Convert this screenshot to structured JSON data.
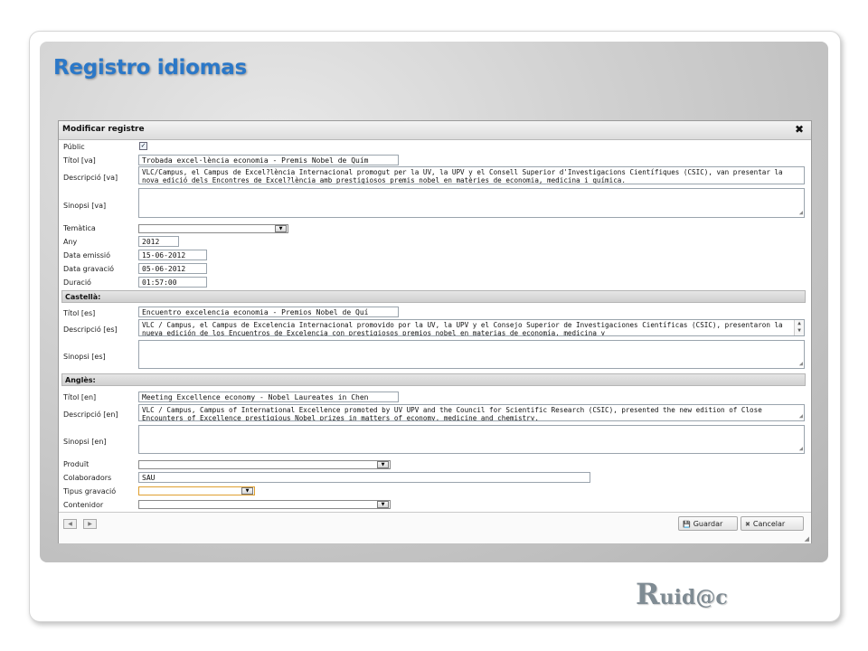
{
  "slide": {
    "title": "Registro idiomas",
    "logo_initial": "R",
    "logo_rest": "uid@c"
  },
  "dialog": {
    "title": "Modificar registre",
    "close_icon": "✖",
    "labels": {
      "public": "Públic",
      "titol_va": "Títol [va]",
      "descripcio_va": "Descripció [va]",
      "sinopsi_va": "Sinopsi [va]",
      "tematica": "Temàtica",
      "any": "Any",
      "data_emissio": "Data emissió",
      "data_gravacio": "Data gravació",
      "duracio": "Duració",
      "titol_es": "Títol [es]",
      "descripcio_es": "Descripció [es]",
      "sinopsi_es": "Sinopsi [es]",
      "titol_en": "Títol [en]",
      "descripcio_en": "Descripció [en]",
      "sinopsi_en": "Sinopsi [en]",
      "produit": "Produït",
      "colaboradors": "Colaboradors",
      "tipus_gravacio": "Tipus gravació",
      "contenidor": "Contenidor"
    },
    "values": {
      "public_checked": "✓",
      "titol_va": "Trobada excel·lència economia - Premis Nobel de Quím",
      "descripcio_va": "VLC/Campus, el Campus de Excel?lència Internacional promogut per la UV, la UPV y el Consell Superior d'Investigacions Científiques (CSIC), van presentar la nova edició dels  Encontres de Excel?lència amb prestigiosos premis nobel en matèries de economia, medicina i química.",
      "sinopsi_va": "",
      "any": "2012",
      "data_emissio": "15-06-2012",
      "data_gravacio": "05-06-2012",
      "duracio": "01:57:00",
      "titol_es": "Encuentro excelencia economia - Premios Nobel de Quí",
      "descripcio_es": "VLC / Campus, el Campus de Excelencia Internacional promovido por la UV, la UPV y el Consejo Superior de Investigaciones Científicas (CSIC), presentaron la nueva edición de los Encuentros de Excelencia con prestigiosos premios nobel en materias de economía, medicina y",
      "sinopsi_es": "",
      "titol_en": "Meeting Excellence economy - Nobel Laureates in Chen",
      "descripcio_en": "VLC / Campus, Campus of International Excellence promoted by UV UPV and the Council for Scientific Research (CSIC), presented the new edition of Close Encounters of Excellence prestigious Nobel prizes in matters of economy, medicine and chemistry.",
      "sinopsi_en": "",
      "colaboradors": "SAU"
    },
    "sections": {
      "castella": "Castellà:",
      "angles": "Anglès:"
    },
    "buttons": {
      "save": "Guardar",
      "cancel": "Cancelar",
      "save_icon": "💾",
      "cancel_icon": "✖",
      "prev_icon": "◀",
      "next_icon": "▶"
    },
    "colors": {
      "title_blue": "#2b78c8",
      "tipus_gravacio_highlight": "#e8b040"
    }
  }
}
